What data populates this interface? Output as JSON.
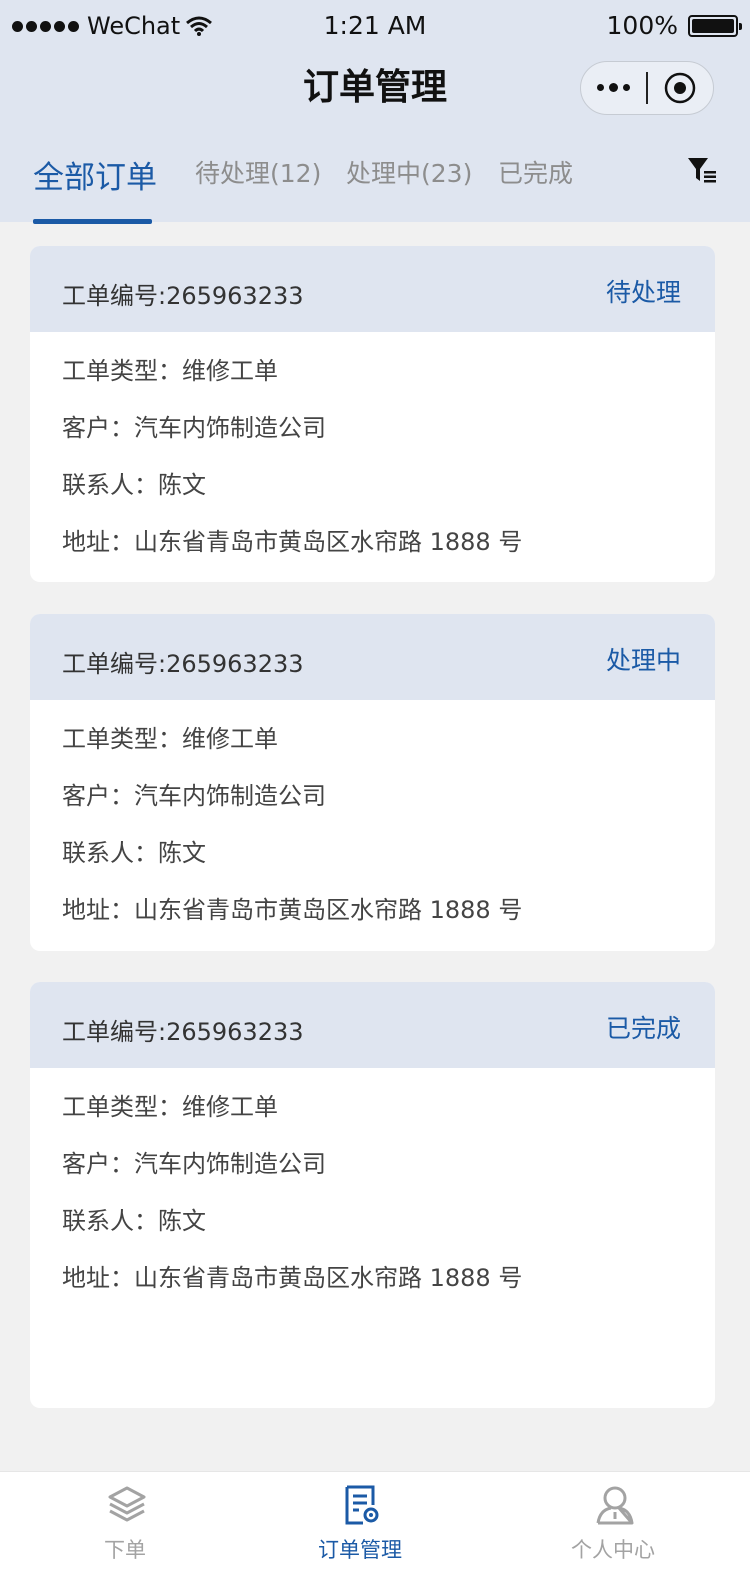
{
  "status_bar": {
    "carrier": "WeChat",
    "time": "1:21 AM",
    "battery": "100%"
  },
  "nav": {
    "title": "订单管理"
  },
  "tabs": [
    {
      "label": "全部订单",
      "active": true
    },
    {
      "label": "待处理(12)",
      "active": false
    },
    {
      "label": "处理中(23)",
      "active": false
    },
    {
      "label": "已完成",
      "active": false
    }
  ],
  "orders": [
    {
      "number": "工单编号:265963233",
      "status": "待处理",
      "type": "工单类型：维修工单",
      "customer": "客户：汽车内饰制造公司",
      "contact": "联系人：陈文",
      "address": "地址：山东省青岛市黄岛区水帘路 1888 号"
    },
    {
      "number": "工单编号:265963233",
      "status": "处理中",
      "type": "工单类型：维修工单",
      "customer": "客户：汽车内饰制造公司",
      "contact": "联系人：陈文",
      "address": "地址：山东省青岛市黄岛区水帘路 1888 号"
    },
    {
      "number": "工单编号:265963233",
      "status": "已完成",
      "type": "工单类型：维修工单",
      "customer": "客户：汽车内饰制造公司",
      "contact": "联系人：陈文",
      "address": "地址：山东省青岛市黄岛区水帘路 1888 号"
    }
  ],
  "tabbar": [
    {
      "label": "下单",
      "icon": "layers-icon",
      "active": false
    },
    {
      "label": "订单管理",
      "icon": "document-settings-icon",
      "active": true
    },
    {
      "label": "个人中心",
      "icon": "user-icon",
      "active": false
    }
  ],
  "colors": {
    "accent": "#1b5aa6",
    "header_bg": "#dfe5f0",
    "page_bg": "#f1f1f1"
  }
}
